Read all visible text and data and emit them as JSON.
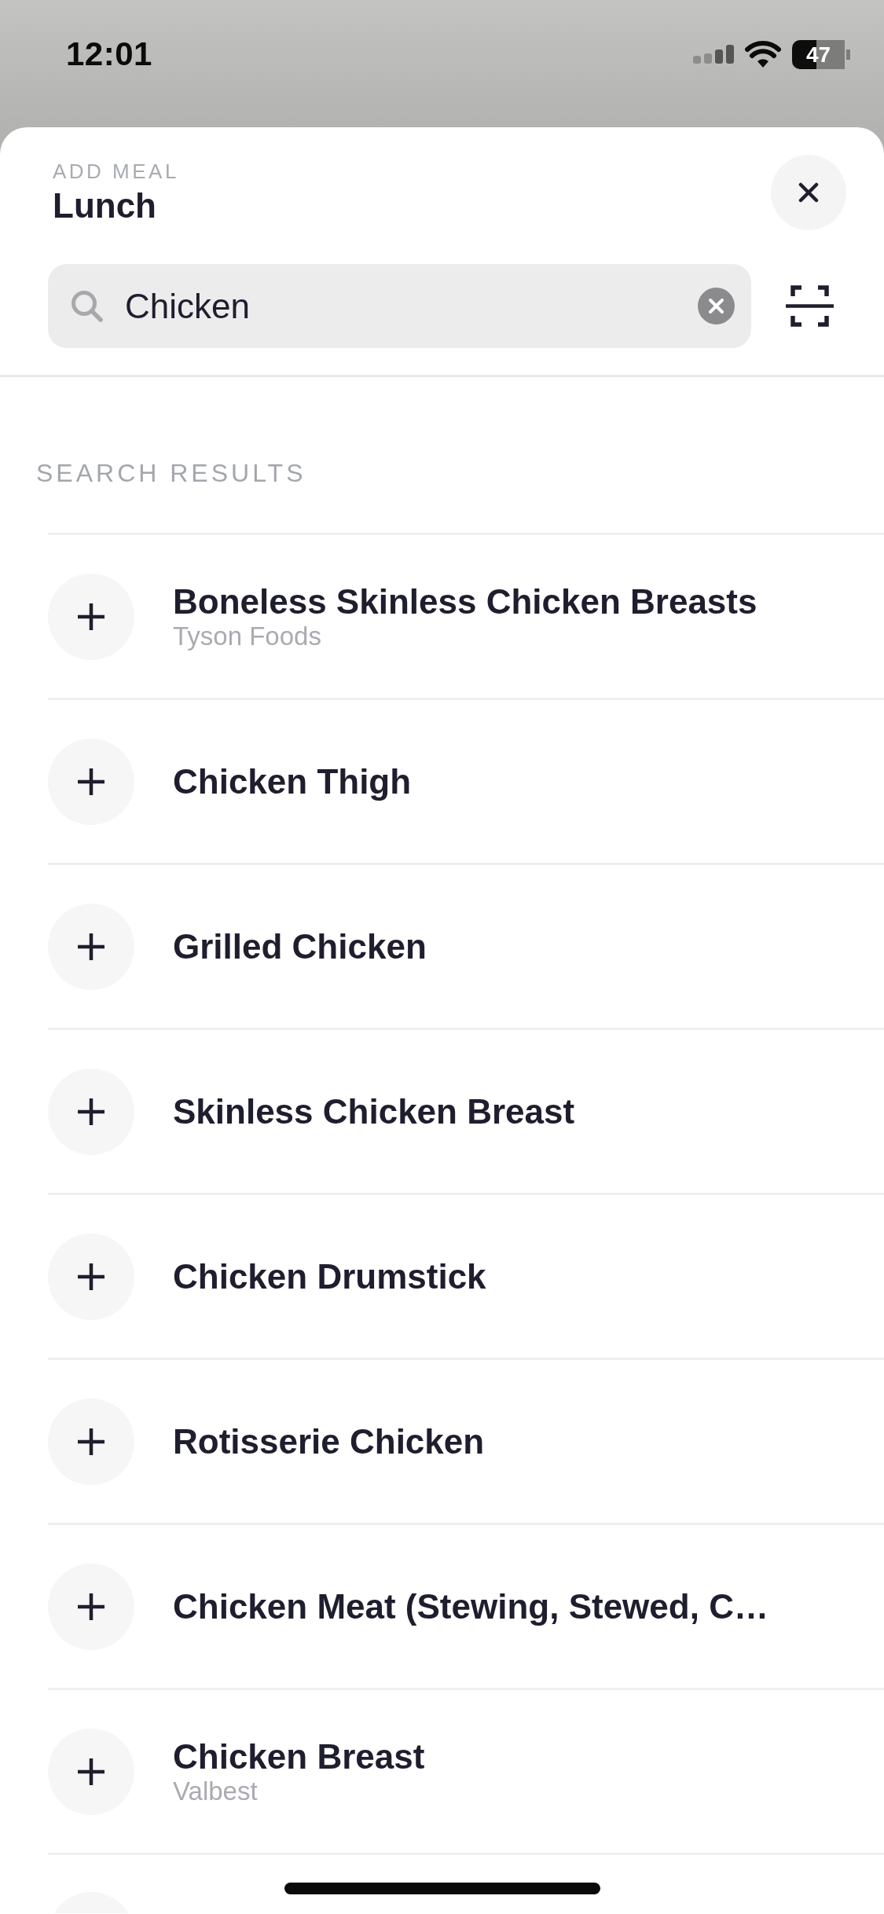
{
  "status_bar": {
    "time": "12:01",
    "battery": "47"
  },
  "header": {
    "eyebrow": "ADD MEAL",
    "title": "Lunch"
  },
  "search": {
    "value": "Chicken"
  },
  "section_title": "SEARCH RESULTS",
  "results": [
    {
      "name": "Boneless Skinless Chicken Breasts",
      "brand": "Tyson Foods"
    },
    {
      "name": "Chicken Thigh"
    },
    {
      "name": "Grilled Chicken"
    },
    {
      "name": "Skinless Chicken Breast"
    },
    {
      "name": "Chicken Drumstick"
    },
    {
      "name": "Rotisserie Chicken"
    },
    {
      "name": "Chicken Meat (Stewing, Stewed, C…"
    },
    {
      "name": "Chicken Breast",
      "brand": "Valbest"
    }
  ],
  "more_below": true
}
